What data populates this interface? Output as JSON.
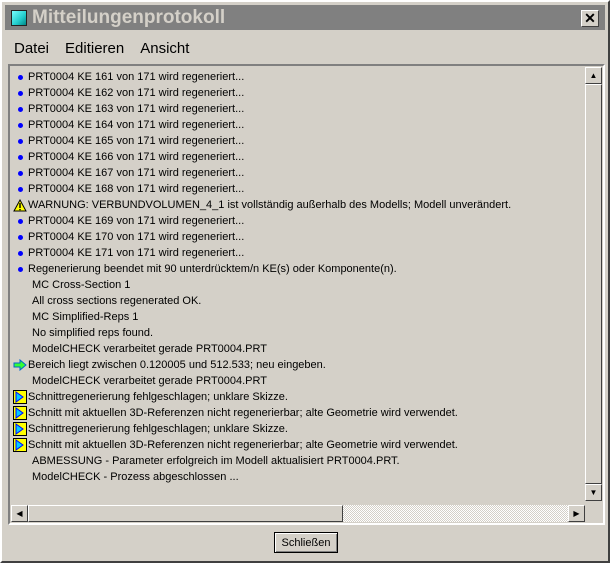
{
  "window": {
    "title": "Mitteilungenprotokoll",
    "close_label": "✕"
  },
  "menu": [
    "Datei",
    "Editieren",
    "Ansicht"
  ],
  "messages": [
    {
      "icon": "info",
      "text": "PRT0004 KE 161 von 171 wird regeneriert..."
    },
    {
      "icon": "info",
      "text": "PRT0004 KE 162 von 171 wird regeneriert..."
    },
    {
      "icon": "info",
      "text": "PRT0004 KE 163 von 171 wird regeneriert..."
    },
    {
      "icon": "info",
      "text": "PRT0004 KE 164 von 171 wird regeneriert..."
    },
    {
      "icon": "info",
      "text": "PRT0004 KE 165 von 171 wird regeneriert..."
    },
    {
      "icon": "info",
      "text": "PRT0004 KE 166 von 171 wird regeneriert..."
    },
    {
      "icon": "info",
      "text": "PRT0004 KE 167 von 171 wird regeneriert..."
    },
    {
      "icon": "info",
      "text": "PRT0004 KE 168 von 171 wird regeneriert..."
    },
    {
      "icon": "warning",
      "text": "WARNUNG: VERBUNDVOLUMEN_4_1 ist vollständig außerhalb des Modells; Modell unverändert."
    },
    {
      "icon": "info",
      "text": "PRT0004 KE 169 von 171 wird regeneriert..."
    },
    {
      "icon": "info",
      "text": "PRT0004 KE 170 von 171 wird regeneriert..."
    },
    {
      "icon": "info",
      "text": "PRT0004 KE 171 von 171 wird regeneriert..."
    },
    {
      "icon": "info",
      "text": "Regenerierung beendet mit 90 unterdrücktem/n KE(s) oder Komponente(n)."
    },
    {
      "icon": "none",
      "text": "MC Cross-Section 1"
    },
    {
      "icon": "none",
      "text": "All cross sections regenerated OK."
    },
    {
      "icon": "none",
      "text": "MC Simplified-Reps 1"
    },
    {
      "icon": "none",
      "text": "No simplified reps found."
    },
    {
      "icon": "none",
      "text": "ModelCHECK verarbeitet gerade PRT0004.PRT"
    },
    {
      "icon": "prompt",
      "text": "Bereich liegt zwischen 0.120005 und 512.533; neu eingeben."
    },
    {
      "icon": "none",
      "text": "ModelCHECK verarbeitet gerade PRT0004.PRT"
    },
    {
      "icon": "sketch",
      "text": "Schnittregenerierung fehlgeschlagen; unklare Skizze."
    },
    {
      "icon": "sketch",
      "text": "Schnitt mit aktuellen 3D-Referenzen nicht regenerierbar; alte Geometrie wird verwendet."
    },
    {
      "icon": "sketch",
      "text": "Schnittregenerierung fehlgeschlagen; unklare Skizze."
    },
    {
      "icon": "sketch",
      "text": "Schnitt mit aktuellen 3D-Referenzen nicht regenerierbar; alte Geometrie wird verwendet."
    },
    {
      "icon": "none",
      "text": "ABMESSUNG - Parameter erfolgreich im Modell aktualisiert PRT0004.PRT."
    },
    {
      "icon": "none",
      "text": "ModelCHECK - Prozess abgeschlossen ..."
    }
  ],
  "footer": {
    "close_button": "Schließen"
  }
}
